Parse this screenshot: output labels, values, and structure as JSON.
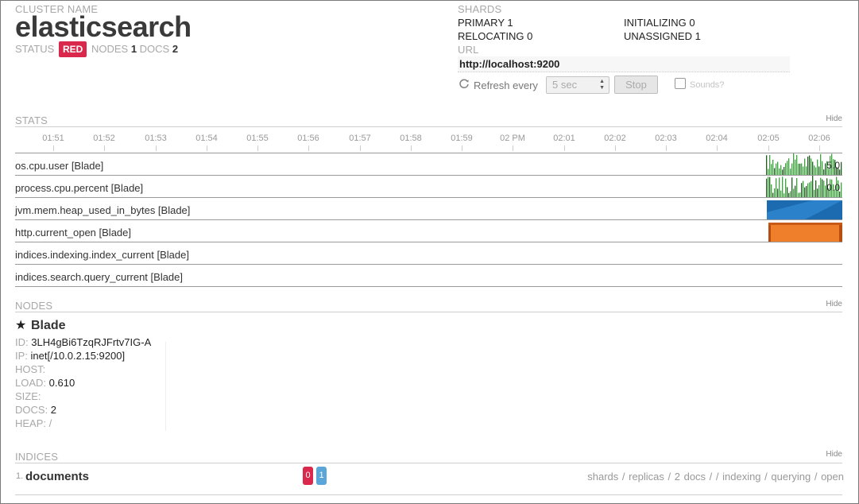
{
  "cluster": {
    "label": "CLUSTER NAME",
    "name": "elasticsearch",
    "status_label": "STATUS",
    "status_value": "RED",
    "nodes_label": "NODES",
    "nodes_value": "1",
    "docs_label": "DOCS",
    "docs_value": "2"
  },
  "shards": {
    "label": "SHARDS",
    "primary": "PRIMARY 1",
    "initializing": "INITIALIZING 0",
    "relocating": "RELOCATING 0",
    "unassigned": "UNASSIGNED 1"
  },
  "url": {
    "label": "URL",
    "value": "http://localhost:9200"
  },
  "refresh": {
    "label": "Refresh every",
    "interval": "5 sec",
    "stop_label": "Stop",
    "sounds_label": "Sounds?"
  },
  "stats": {
    "title": "STATS",
    "hide_label": "Hide",
    "time_ticks": [
      "01:51",
      "01:52",
      "01:53",
      "01:54",
      "01:55",
      "01:56",
      "01:57",
      "01:58",
      "01:59",
      "02 PM",
      "02:01",
      "02:02",
      "02:03",
      "02:04",
      "02:05",
      "02:06"
    ],
    "metrics": [
      {
        "label": "os.cpu.user [Blade]",
        "value": "5.0"
      },
      {
        "label": "process.cpu.percent [Blade]",
        "value": "0.0"
      },
      {
        "label": "jvm.mem.heap_used_in_bytes [Blade]"
      },
      {
        "label": "http.current_open [Blade]"
      },
      {
        "label": "indices.indexing.index_current [Blade]"
      },
      {
        "label": "indices.search.query_current [Blade]"
      }
    ]
  },
  "nodes": {
    "title": "NODES",
    "hide_label": "Hide",
    "node": {
      "name": "Blade",
      "id_label": "ID:",
      "id": "3LH4gBi6TzqRJFrtv7IG-A",
      "ip_label": "IP:",
      "ip": "inet[/10.0.2.15:9200]",
      "host_label": "HOST:",
      "host": "",
      "load_label": "LOAD:",
      "load": "0.610",
      "size_label": "SIZE:",
      "size": "",
      "docs_label": "DOCS:",
      "docs": "2",
      "heap_label": "HEAP:",
      "heap": "/"
    }
  },
  "indices": {
    "title": "INDICES",
    "hide_label": "Hide",
    "items": [
      {
        "number": "1.",
        "name": "documents",
        "badge_red": "0",
        "badge_blue": "1",
        "stats": "shards / replicas / 2 docs / / indexing / querying / open"
      }
    ]
  },
  "colors": {
    "status_red": "#d9284c",
    "cpu_green": "#3da33d",
    "heap_blue": "#1f6fb5",
    "http_orange": "#f07f2c",
    "badge_blue": "#5aa6d8"
  }
}
